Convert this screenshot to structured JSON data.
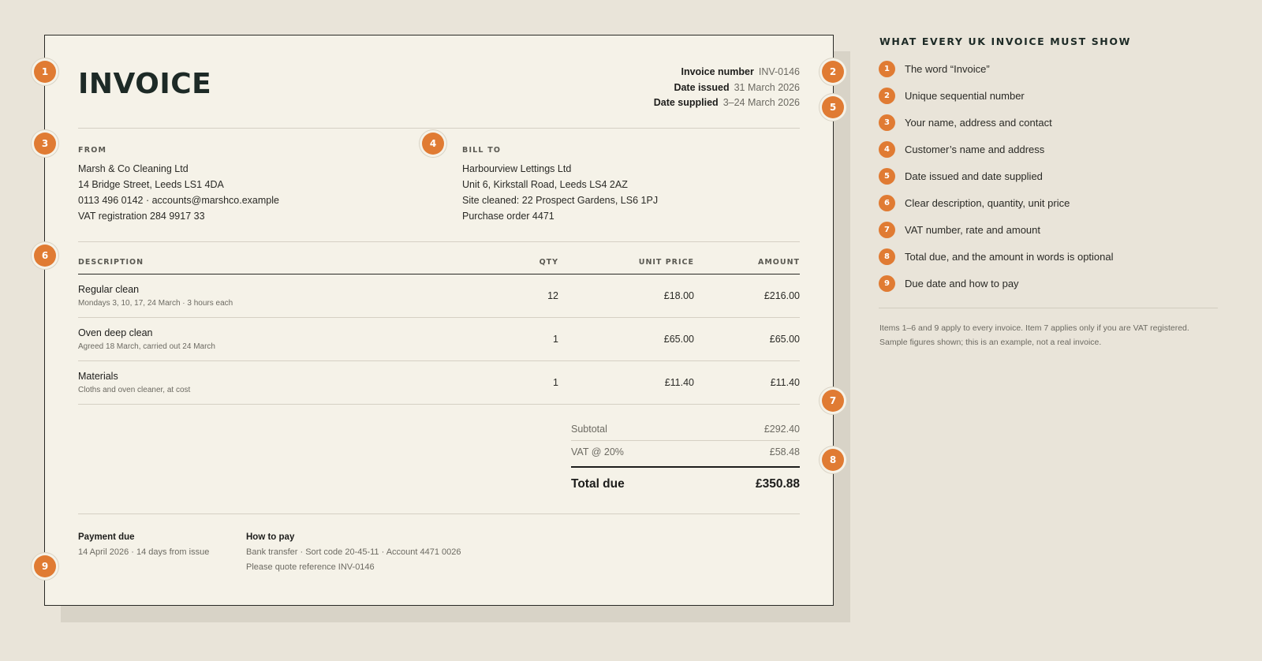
{
  "invoice": {
    "title": "INVOICE",
    "meta": [
      {
        "label": "Invoice number",
        "value": "INV-0146"
      },
      {
        "label": "Date issued",
        "value": "31 March 2026"
      },
      {
        "label": "Date supplied",
        "value": "3–24 March 2026"
      }
    ],
    "from": {
      "heading": "FROM",
      "lines": [
        "Marsh & Co Cleaning Ltd",
        "14 Bridge Street, Leeds LS1 4DA",
        "0113 496 0142 · accounts@marshco.example",
        "VAT registration 284 9917 33"
      ]
    },
    "bill_to": {
      "heading": "BILL TO",
      "lines": [
        "Harbourview Lettings Ltd",
        "Unit 6, Kirkstall Road, Leeds LS4 2AZ",
        "Site cleaned: 22 Prospect Gardens, LS6 1PJ",
        "Purchase order 4471"
      ]
    },
    "table": {
      "headers": {
        "description": "DESCRIPTION",
        "qty": "QTY",
        "unit_price": "UNIT PRICE",
        "amount": "AMOUNT"
      },
      "rows": [
        {
          "title": "Regular clean",
          "sub": "Mondays 3, 10, 17, 24 March · 3 hours each",
          "qty": "12",
          "unit_price": "£18.00",
          "amount": "£216.00"
        },
        {
          "title": "Oven deep clean",
          "sub": "Agreed 18 March, carried out 24 March",
          "qty": "1",
          "unit_price": "£65.00",
          "amount": "£65.00"
        },
        {
          "title": "Materials",
          "sub": "Cloths and oven cleaner, at cost",
          "qty": "1",
          "unit_price": "£11.40",
          "amount": "£11.40"
        }
      ]
    },
    "totals": {
      "subtotal_label": "Subtotal",
      "subtotal": "£292.40",
      "vat_label": "VAT @ 20%",
      "vat": "£58.48",
      "total_label": "Total due",
      "total": "£350.88"
    },
    "payment": {
      "due_heading": "Payment due",
      "due_text": "14 April 2026 · 14 days from issue",
      "how_heading": "How to pay",
      "how_lines": [
        "Bank transfer · Sort code 20-45-11 · Account 4471 0026",
        "Please quote reference INV-0146"
      ]
    },
    "markers": [
      "1",
      "2",
      "3",
      "4",
      "5",
      "6",
      "7",
      "8",
      "9"
    ]
  },
  "sidebar": {
    "title": "WHAT EVERY UK INVOICE MUST SHOW",
    "items": [
      {
        "num": "1",
        "text": "The word “Invoice”"
      },
      {
        "num": "2",
        "text": "Unique sequential number"
      },
      {
        "num": "3",
        "text": "Your name, address and contact"
      },
      {
        "num": "4",
        "text": "Customer’s name and address"
      },
      {
        "num": "5",
        "text": "Date issued and date supplied"
      },
      {
        "num": "6",
        "text": "Clear description, quantity, unit price"
      },
      {
        "num": "7",
        "text": "VAT number, rate and amount"
      },
      {
        "num": "8",
        "text": "Total due, and the amount in words is optional"
      },
      {
        "num": "9",
        "text": "Due date and how to pay"
      }
    ],
    "note_lines": [
      "Items 1–6 and 9 apply to every invoice. Item 7 applies only if you are VAT registered.",
      "Sample figures shown; this is an example, not a real invoice."
    ]
  },
  "colors": {
    "accent": "#e07b33",
    "page_bg": "#e9e4d9",
    "paper": "#f5f2e8",
    "ink": "#1d2a26"
  }
}
